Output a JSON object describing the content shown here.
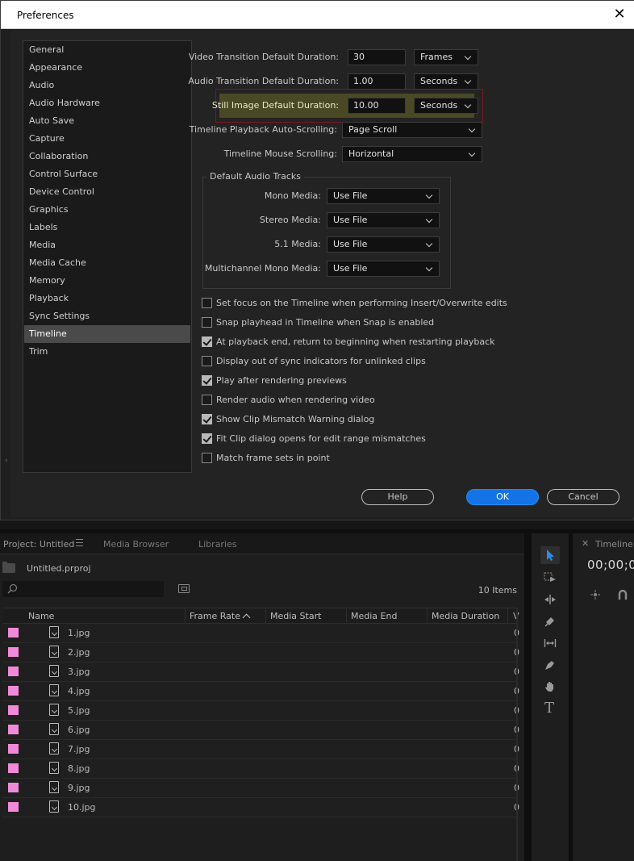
{
  "dialog": {
    "title": "Preferences",
    "close_label": "✕",
    "categories": [
      "General",
      "Appearance",
      "Audio",
      "Audio Hardware",
      "Auto Save",
      "Capture",
      "Collaboration",
      "Control Surface",
      "Device Control",
      "Graphics",
      "Labels",
      "Media",
      "Media Cache",
      "Memory",
      "Playback",
      "Sync Settings",
      "Timeline",
      "Trim"
    ],
    "selected_category": "Timeline",
    "scroll_marker": "‹",
    "settings": {
      "video_transition": {
        "label": "Video Transition Default Duration:",
        "value": "30",
        "unit": "Frames"
      },
      "audio_transition": {
        "label": "Audio Transition Default Duration:",
        "value": "1.00",
        "unit": "Seconds"
      },
      "still_image": {
        "label": "Still Image Default Duration:",
        "value": "10.00",
        "unit": "Seconds"
      },
      "auto_scrolling": {
        "label": "Timeline Playback Auto-Scrolling:",
        "value": "Page Scroll"
      },
      "mouse_scrolling": {
        "label": "Timeline Mouse Scrolling:",
        "value": "Horizontal"
      }
    },
    "audio_tracks": {
      "title": "Default Audio Tracks",
      "mono": {
        "label": "Mono Media:",
        "value": "Use File"
      },
      "stereo": {
        "label": "Stereo Media:",
        "value": "Use File"
      },
      "five_one": {
        "label": "5.1 Media:",
        "value": "Use File"
      },
      "multichannel": {
        "label": "Multichannel Mono Media:",
        "value": "Use File"
      }
    },
    "checkboxes": [
      {
        "label": "Set focus on the Timeline when performing Insert/Overwrite edits",
        "checked": false
      },
      {
        "label": "Snap playhead in Timeline when Snap is enabled",
        "checked": false
      },
      {
        "label": "At playback end, return to beginning when restarting playback",
        "checked": true
      },
      {
        "label": "Display out of sync indicators for unlinked clips",
        "checked": false
      },
      {
        "label": "Play after rendering previews",
        "checked": true
      },
      {
        "label": "Render audio when rendering video",
        "checked": false
      },
      {
        "label": "Show Clip Mismatch Warning dialog",
        "checked": true
      },
      {
        "label": "Fit Clip dialog opens for edit range mismatches",
        "checked": true
      },
      {
        "label": "Match frame sets in point",
        "checked": false
      }
    ],
    "buttons": {
      "help": "Help",
      "ok": "OK",
      "cancel": "Cancel"
    },
    "colors": {
      "ok_button": "#1473e6",
      "highlight_border": "#7a1825"
    }
  },
  "project": {
    "tabs": [
      "Project: Untitled",
      "Media Browser",
      "Libraries"
    ],
    "filename": "Untitled.prproj",
    "items_count": "10 Items",
    "columns": [
      "Name",
      "Frame Rate",
      "Media Start",
      "Media End",
      "Media Duration",
      "V"
    ],
    "label_color": "#f08ad8",
    "files": [
      {
        "name": "1.jpg",
        "v": "0"
      },
      {
        "name": "2.jpg",
        "v": "0"
      },
      {
        "name": "3.jpg",
        "v": "0"
      },
      {
        "name": "4.jpg",
        "v": "0"
      },
      {
        "name": "5.jpg",
        "v": "0"
      },
      {
        "name": "6.jpg",
        "v": "0"
      },
      {
        "name": "7.jpg",
        "v": "0"
      },
      {
        "name": "8.jpg",
        "v": "0"
      },
      {
        "name": "9.jpg",
        "v": "0"
      },
      {
        "name": "10.jpg",
        "v": "0"
      }
    ]
  },
  "timeline": {
    "close_label": "✕",
    "title": "Timeline:",
    "timecode": "00;00;0"
  },
  "tools": {
    "names": [
      "selection-tool",
      "track-select-tool",
      "ripple-edit-tool",
      "razor-tool",
      "slip-tool",
      "pen-tool",
      "hand-tool",
      "type-tool"
    ],
    "type_glyph": "T"
  }
}
